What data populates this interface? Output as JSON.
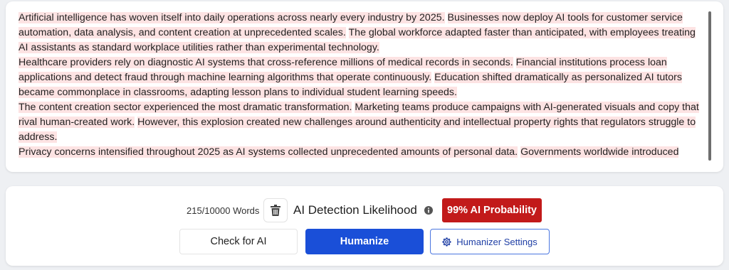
{
  "editor": {
    "paragraphs": [
      {
        "sentences": [
          "Artificial intelligence has woven itself into daily operations across nearly every industry by 2025.",
          "Businesses now deploy AI tools for customer service automation, data analysis, and content creation at unprecedented scales.",
          "The global workforce adapted faster than anticipated, with employees treating AI assistants as standard workplace utilities rather than experimental technology."
        ]
      },
      {
        "sentences": [
          "Healthcare providers rely on diagnostic AI systems that cross-reference millions of medical records in seconds.",
          "Financial institutions process loan applications and detect fraud through machine learning algorithms that operate continuously.",
          "Education shifted dramatically as personalized AI tutors became commonplace in classrooms, adapting lesson plans to individual student learning speeds."
        ]
      },
      {
        "sentences": [
          "The content creation sector experienced the most dramatic transformation.",
          "Marketing teams produce campaigns with AI-generated visuals and copy that rival human-created work.",
          "However, this explosion created new challenges around authenticity and intellectual property rights that regulators struggle to address."
        ]
      },
      {
        "sentences": [
          "Privacy concerns intensified throughout 2025 as AI systems collected unprecedented amounts of personal data.",
          "Governments worldwide introduced"
        ]
      }
    ],
    "highlight_color": "#fde3e3"
  },
  "controls": {
    "word_count": "215/10000 Words",
    "trash_icon": "trash-icon",
    "detection_title": "AI Detection Likelihood",
    "info_icon": "info-icon",
    "probability_label": "99% AI Probability",
    "probability_color": "#c21a1a",
    "check_label": "Check for AI",
    "humanize_label": "Humanize",
    "humanize_color": "#1a4fd8",
    "settings_icon": "gear-icon",
    "settings_label": "Humanizer Settings"
  }
}
